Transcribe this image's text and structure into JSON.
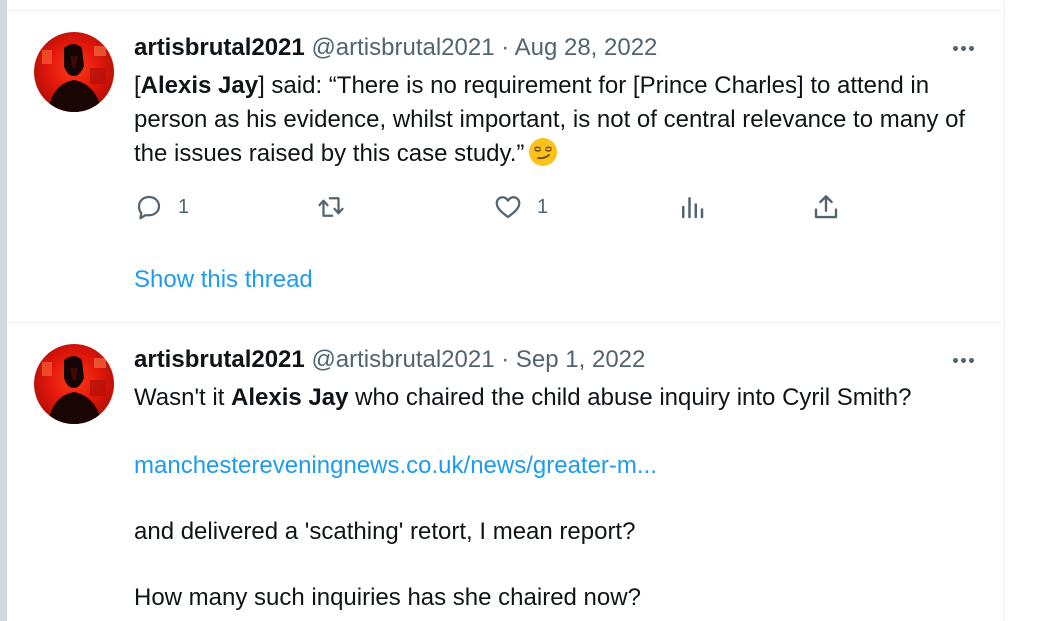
{
  "tweets": [
    {
      "name": "artisbrutal2021",
      "handle": "@artisbrutal2021",
      "separator": "·",
      "date": "Aug 28, 2022",
      "text": {
        "p1": "[",
        "bold1": "Alexis Jay",
        "p2": "] said: “There is no requirement for [Prince Charles] to attend in person as his evidence, whilst important, is not of central relevance to many of the issues raised by this case study.”"
      },
      "emoji": "smirking-face",
      "replies": "1",
      "retweets": "",
      "likes": "1",
      "show_thread": "Show this thread"
    },
    {
      "name": "artisbrutal2021",
      "handle": "@artisbrutal2021",
      "separator": "·",
      "date": "Sep 1, 2022",
      "text": {
        "p1": "Wasn't it ",
        "bold1": "Alexis Jay",
        "p2": " who chaired the child abuse inquiry into Cyril Smith?",
        "link": "manchestereveningnews.co.uk/news/greater-m...",
        "p3": "and delivered a 'scathing' retort, I mean report?",
        "p4": "How many such inquiries has she chaired now?"
      }
    }
  ],
  "icons": {
    "more": "more-horizontal-icon",
    "reply": "reply-icon",
    "retweet": "retweet-icon",
    "like": "heart-icon",
    "views": "views-icon",
    "share": "share-icon"
  },
  "colors": {
    "link": "#1d9bf0",
    "secondary_text": "#536471",
    "avatar_red": "#e0160a"
  }
}
